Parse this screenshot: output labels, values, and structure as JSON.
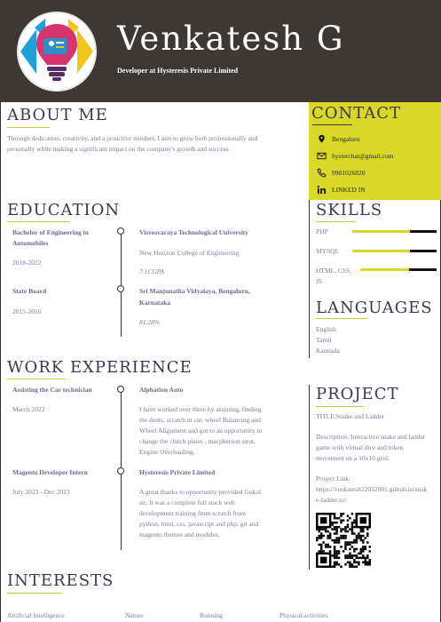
{
  "header": {
    "name": "Venkatesh G",
    "role": "Developer at Hysteresis Private Limited"
  },
  "about": {
    "title": "ABOUT ME",
    "text_line1": "Through dedication, creativity, and a proactive mindset, I aim to grow both professionally and",
    "text_line2": "personally while making a significant impact on the company's growth and success"
  },
  "contact": {
    "title": "CONTACT",
    "location": "Bengaluru",
    "email": "hysterchat@gmail.com",
    "phone": "9901026820",
    "linkedin": "LINKED IN"
  },
  "education": {
    "title": "EDUCATION",
    "items": [
      {
        "degree_line1": "Bachelor of Engineering in",
        "degree_line2": "Automobiles",
        "years": "2018-2022",
        "university": "Visvesvaraya Technological University",
        "college": "New Horizon College of Engineering",
        "score": "7.1CGPA"
      },
      {
        "degree_line1": "State Board",
        "degree_line2": "",
        "years": "2015-2016",
        "university": "Sri Manjunatha Vidyalaya, Bengaluru,",
        "college": "Karnataka",
        "score": "81.28%"
      }
    ]
  },
  "skills": {
    "title": "SKILLS",
    "items": [
      {
        "name": "PHP",
        "name2": "",
        "level": 0.68
      },
      {
        "name": "MYSQL",
        "name2": "",
        "level": 0.68
      },
      {
        "name": "HTML, CSS,",
        "name2": "JS",
        "level": 0.64
      }
    ]
  },
  "languages": {
    "title": "LANGUAGES",
    "items": [
      "English",
      "Tamil",
      "Kannada"
    ]
  },
  "work": {
    "title": "WORK EXPERIENCE",
    "items": [
      {
        "role": "Assisting the Car technician",
        "date": "March 2022",
        "company": "Alphation Auto",
        "desc": [
          "I have worked over there by assisting, finding",
          "the dents, scratch in car, wheel Balancing and",
          "Wheel Alignment and got to an opportunity to",
          "change the clutch plates , macpherson strut,",
          "Engine Overhauling."
        ]
      },
      {
        "role": "Magento Developer Intern",
        "date": "July 2023 - Dec 2023",
        "company": "Hysteresis Private Limited",
        "desc": [
          "A great thanks to opportunity provided Gokul",
          "sir, It was a complete full stack web",
          "development training from scratch from",
          "python, html, css, javascript and php, git and",
          "magento themes and modules."
        ]
      }
    ]
  },
  "project": {
    "title": "PROJECT",
    "name": "TITLE:Snake and Ladder",
    "desc": [
      "Description: Interactive snake and ladder",
      "game with virtual dice and token",
      "movement on a 10x10 grid."
    ],
    "link_label": "Project Link:",
    "link": [
      "https://venkatesh22032001.github.io/snak",
      "e-ladder.io/"
    ]
  },
  "interests": {
    "title": "INTERESTS",
    "items": [
      "Artificial Intelligence",
      "Nature",
      "Running",
      "Physical activities"
    ]
  },
  "colors": {
    "header_bg": "#3d3834",
    "accent": "#d9d826",
    "text": "#7a7d96"
  }
}
